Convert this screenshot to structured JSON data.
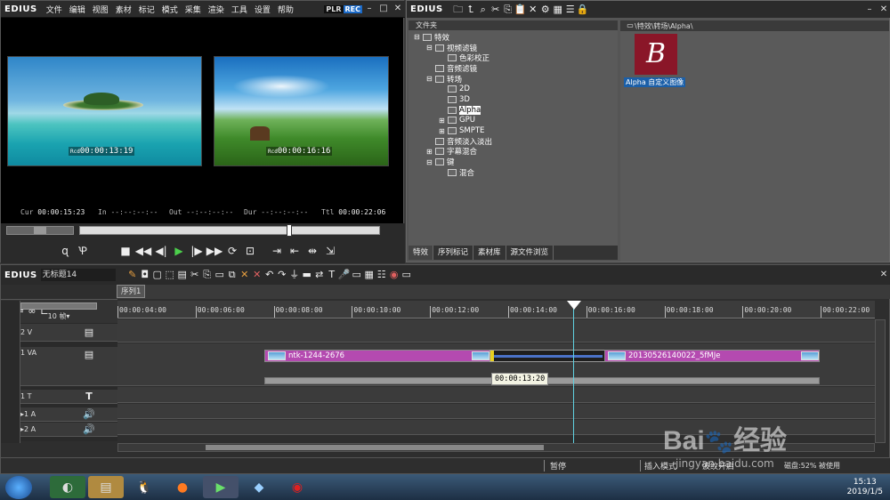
{
  "preview": {
    "logo": "EDIUS",
    "menu": [
      "文件",
      "编辑",
      "视图",
      "素材",
      "标记",
      "模式",
      "采集",
      "渲染",
      "工具",
      "设置",
      "帮助"
    ],
    "plr": "PLR",
    "rec": "REC",
    "left_tc_label": "Rcd",
    "left_tc": "00:00:13:19",
    "right_tc_label": "Rcd",
    "right_tc": "00:00:16:16",
    "cur_label": "Cur",
    "cur": "00:00:15:23",
    "in_label": "In",
    "in": "--:--:--:--",
    "out_label": "Out",
    "out": "--:--:--:--",
    "dur_label": "Dur",
    "dur": "--:--:--:--",
    "ttl_label": "Ttl",
    "ttl": "00:00:22:06"
  },
  "bin": {
    "logo": "EDIUS",
    "folder_header": "文件夹",
    "path": "\\特效\\转场\\Alpha\\",
    "tree": [
      {
        "label": "特效",
        "indent": 0,
        "exp": "⊟"
      },
      {
        "label": "视频滤镜",
        "indent": 1,
        "exp": "⊟"
      },
      {
        "label": "色彩校正",
        "indent": 2,
        "exp": ""
      },
      {
        "label": "音频滤镜",
        "indent": 1,
        "exp": ""
      },
      {
        "label": "转场",
        "indent": 1,
        "exp": "⊟"
      },
      {
        "label": "2D",
        "indent": 2,
        "exp": ""
      },
      {
        "label": "3D",
        "indent": 2,
        "exp": ""
      },
      {
        "label": "Alpha",
        "indent": 2,
        "exp": "",
        "selected": true
      },
      {
        "label": "GPU",
        "indent": 2,
        "exp": "⊞"
      },
      {
        "label": "SMPTE",
        "indent": 2,
        "exp": "⊞"
      },
      {
        "label": "音频淡入淡出",
        "indent": 1,
        "exp": ""
      },
      {
        "label": "字幕混合",
        "indent": 1,
        "exp": "⊞"
      },
      {
        "label": "键",
        "indent": 1,
        "exp": "⊟"
      },
      {
        "label": "混合",
        "indent": 2,
        "exp": ""
      }
    ],
    "effect_letter": "B",
    "effect_label": "Alpha 自定义图像",
    "tabs": [
      "特效",
      "序列标记",
      "素材库",
      "源文件浏览"
    ]
  },
  "timeline": {
    "logo": "EDIUS",
    "project": "无标题14",
    "sequence_tab": "序列1",
    "zoom": "10 帧",
    "ruler": [
      "00:00:04:00",
      "00:00:06:00",
      "00:00:08:00",
      "00:00:10:00",
      "00:00:12:00",
      "00:00:14:00",
      "00:00:16:00",
      "00:00:18:00",
      "00:00:20:00",
      "00:00:22:00"
    ],
    "tracks": {
      "v2": "2 V",
      "va1": "1 VA",
      "t1": "1 T",
      "a1": "1 A",
      "a2": "2 A"
    },
    "clip1": "ntk-1244-2676",
    "clip2": "20130526140022_5fMJe",
    "tooltip": "00:00:13:20",
    "status": {
      "state": "暂停",
      "mode": "插入模式",
      "ripple": "波纹开启",
      "disk": "磁盘:52% 被使用"
    }
  },
  "taskbar": {
    "time": "15:13",
    "date": "2019/1/5"
  },
  "watermark": {
    "brand": "Bai",
    "brand2": "经验",
    "url": "jingyan.baidu.com"
  }
}
